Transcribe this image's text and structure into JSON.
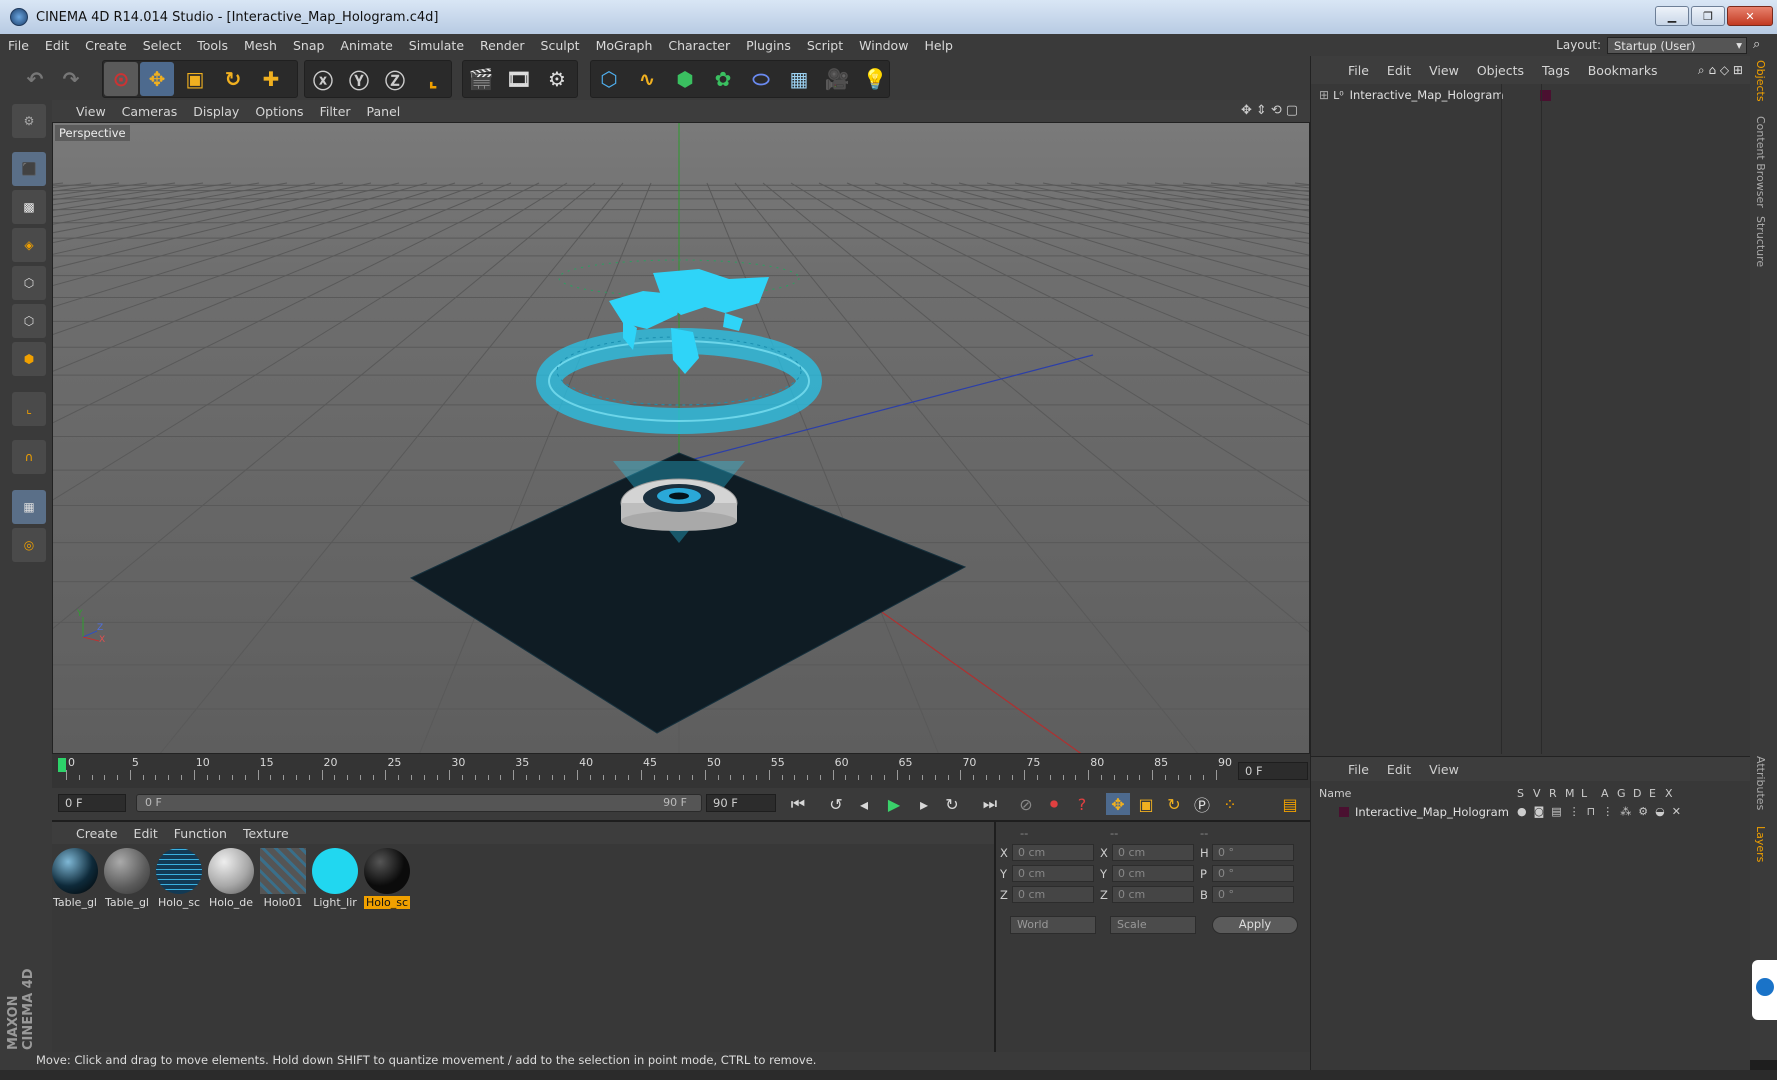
{
  "window": {
    "title": "CINEMA 4D R14.014 Studio - [Interactive_Map_Hologram.c4d]"
  },
  "menubar": {
    "items": [
      "File",
      "Edit",
      "Create",
      "Select",
      "Tools",
      "Mesh",
      "Snap",
      "Animate",
      "Simulate",
      "Render",
      "Sculpt",
      "MoGraph",
      "Character",
      "Plugins",
      "Script",
      "Window",
      "Help"
    ],
    "layout_label": "Layout:",
    "layout_value": "Startup (User)"
  },
  "viewport": {
    "menu": [
      "View",
      "Cameras",
      "Display",
      "Options",
      "Filter",
      "Panel"
    ],
    "label": "Perspective",
    "axis_y": "Y",
    "axis_z": "Z",
    "axis_x": "X"
  },
  "timeline": {
    "ticks": [
      "0",
      "5",
      "10",
      "15",
      "20",
      "25",
      "30",
      "35",
      "40",
      "45",
      "50",
      "55",
      "60",
      "65",
      "70",
      "75",
      "80",
      "85",
      "90"
    ],
    "current_frame_right": "0 F",
    "start_field": "0 F",
    "range_left": "0 F",
    "range_right": "90 F",
    "end_field": "90 F"
  },
  "materials": {
    "menu": [
      "Create",
      "Edit",
      "Function",
      "Texture"
    ],
    "items": [
      {
        "label": "Table_gl",
        "color": "#0e2a3a"
      },
      {
        "label": "Table_gl",
        "color": "#6b6b6b"
      },
      {
        "label": "Holo_sc",
        "color": "#123a55"
      },
      {
        "label": "Holo_de",
        "color": "#a8a8a8"
      },
      {
        "label": "Holo01",
        "color": "#3a6f8a"
      },
      {
        "label": "Light_lir",
        "color": "#21d7f0"
      },
      {
        "label": "Holo_sc",
        "color": "#0b0b0b"
      }
    ]
  },
  "coordinates": {
    "col_headers": [
      "--",
      "--",
      "--"
    ],
    "rows": [
      {
        "a": "X",
        "av": "0 cm",
        "b": "X",
        "bv": "0 cm",
        "c": "H",
        "cv": "0 °"
      },
      {
        "a": "Y",
        "av": "0 cm",
        "b": "Y",
        "bv": "0 cm",
        "c": "P",
        "cv": "0 °"
      },
      {
        "a": "Z",
        "av": "0 cm",
        "b": "Z",
        "bv": "0 cm",
        "c": "B",
        "cv": "0 °"
      }
    ],
    "dropdown1": "World",
    "dropdown2": "Scale",
    "apply": "Apply"
  },
  "objects": {
    "menu": [
      "File",
      "Edit",
      "View",
      "Objects",
      "Tags",
      "Bookmarks"
    ],
    "items": [
      "Interactive_Map_Hologram"
    ]
  },
  "attributes": {
    "menu": [
      "File",
      "Edit",
      "View"
    ],
    "name_header": "Name",
    "flag_headers": [
      "S",
      "V",
      "R",
      "M",
      "L",
      "A",
      "G",
      "D",
      "E",
      "X"
    ],
    "items": [
      "Interactive_Map_Hologram"
    ]
  },
  "sidetabs": [
    "Objects",
    "Content Browser",
    "Structure",
    "Attributes",
    "Layers"
  ],
  "status": "Move: Click and drag to move elements. Hold down SHIFT to quantize movement / add to the selection in point mode, CTRL to remove.",
  "brand": "MAXON CINEMA 4D",
  "colors": {
    "accent": "#21d7f0",
    "selected": "#f0a000"
  }
}
